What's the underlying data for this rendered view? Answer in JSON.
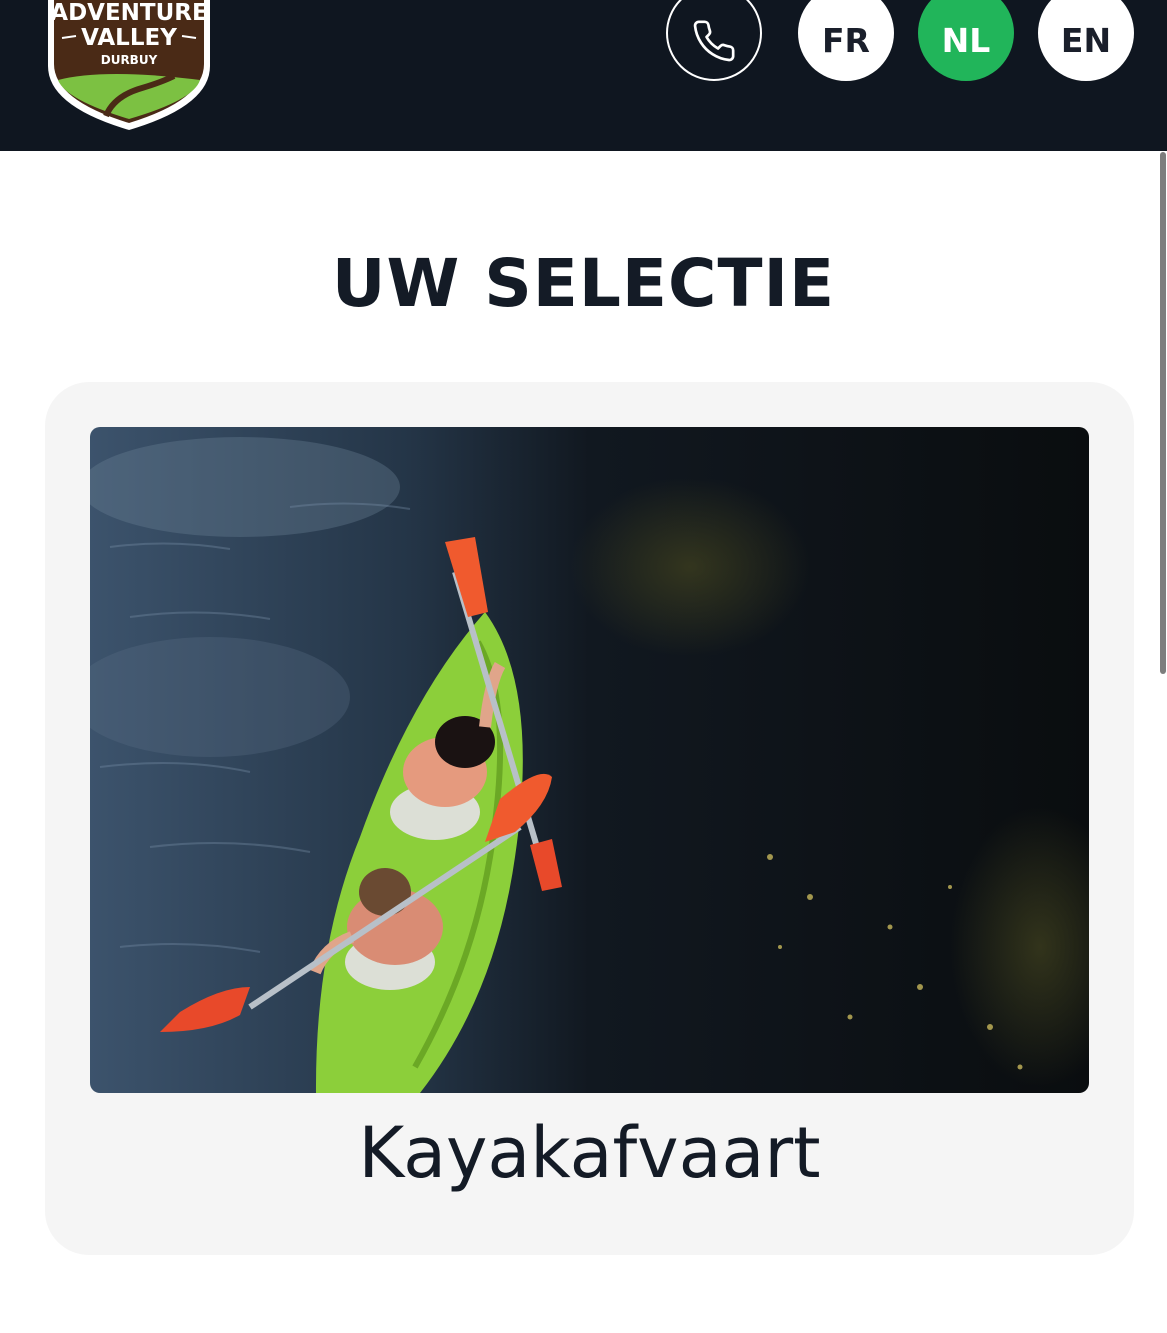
{
  "header": {
    "logo": {
      "line1": "ADVENTURE",
      "line2": "VALLEY",
      "line3": "DURBUY",
      "icon": "adventure-valley-shield-logo"
    },
    "phone": {
      "icon": "phone-icon"
    },
    "languages": [
      {
        "code": "FR",
        "active": false
      },
      {
        "code": "NL",
        "active": true
      },
      {
        "code": "EN",
        "active": false
      }
    ]
  },
  "main": {
    "title": "UW SELECTIE",
    "selection": [
      {
        "label": "Kayakafvaart",
        "image": "two people paddling a green kayak on dark river water, top view"
      }
    ]
  },
  "colors": {
    "header_bg": "#0f1620",
    "active_language": "#21b55a",
    "text_dark": "#141b26",
    "card_bg": "#f5f5f5"
  }
}
